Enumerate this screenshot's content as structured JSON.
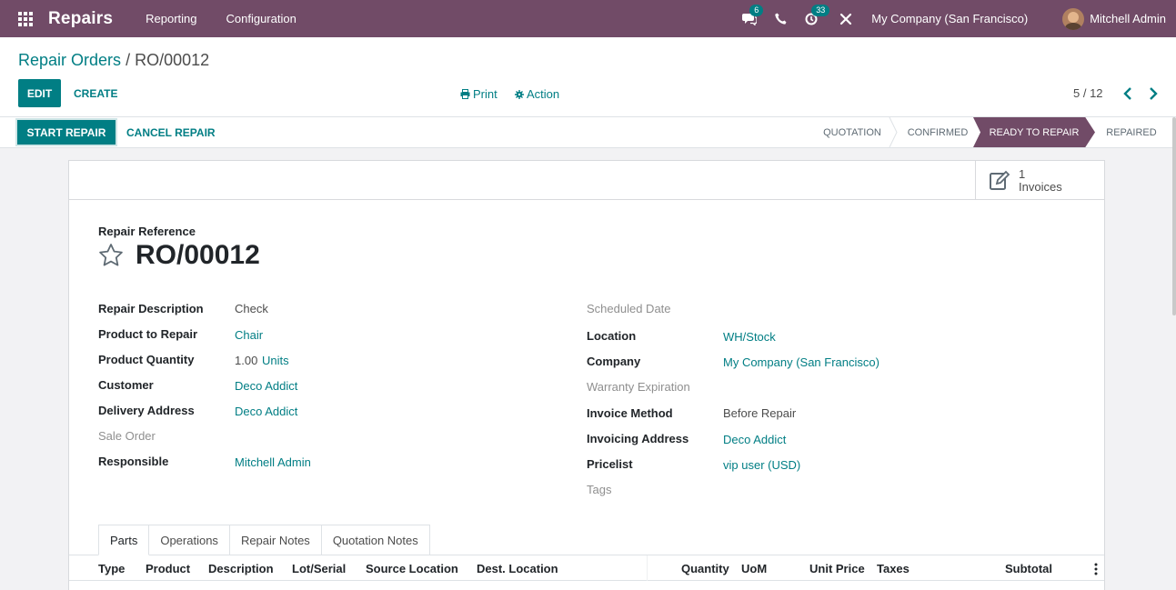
{
  "topbar": {
    "app_name": "Repairs",
    "menu": [
      "Reporting",
      "Configuration"
    ],
    "chat_badge": "6",
    "activity_badge": "33",
    "company": "My Company (San Francisco)",
    "user": "Mitchell Admin"
  },
  "control_panel": {
    "breadcrumb_parent": "Repair Orders",
    "breadcrumb_sep": "/",
    "breadcrumb_current": "RO/00012",
    "edit_label": "EDIT",
    "create_label": "CREATE",
    "print_label": "Print",
    "action_label": "Action",
    "pager": "5 / 12"
  },
  "statusbar": {
    "start_label": "START REPAIR",
    "cancel_label": "CANCEL REPAIR",
    "stages": [
      "QUOTATION",
      "CONFIRMED",
      "READY TO REPAIR",
      "REPAIRED"
    ],
    "active_stage": "READY TO REPAIR"
  },
  "smart_button": {
    "count": "1",
    "label": "Invoices"
  },
  "form": {
    "ref_label": "Repair Reference",
    "ref_value": "RO/00012",
    "left": {
      "repair_description_label": "Repair Description",
      "repair_description": "Check",
      "product_label": "Product to Repair",
      "product": "Chair",
      "quantity_label": "Product Quantity",
      "quantity": "1.00",
      "quantity_uom": "Units",
      "customer_label": "Customer",
      "customer": "Deco Addict",
      "delivery_label": "Delivery Address",
      "delivery": "Deco Addict",
      "sale_order_label": "Sale Order",
      "responsible_label": "Responsible",
      "responsible": "Mitchell Admin"
    },
    "right": {
      "scheduled_label": "Scheduled Date",
      "location_label": "Location",
      "location": "WH/Stock",
      "company_label": "Company",
      "company": "My Company (San Francisco)",
      "warranty_label": "Warranty Expiration",
      "invoice_method_label": "Invoice Method",
      "invoice_method": "Before Repair",
      "invoicing_address_label": "Invoicing Address",
      "invoicing_address": "Deco Addict",
      "pricelist_label": "Pricelist",
      "pricelist": "vip user (USD)",
      "tags_label": "Tags"
    }
  },
  "tabs": [
    "Parts",
    "Operations",
    "Repair Notes",
    "Quotation Notes"
  ],
  "table": {
    "columns": [
      "Type",
      "Product",
      "Description",
      "Lot/Serial",
      "Source Location",
      "Dest. Location",
      "Quantity",
      "UoM",
      "Unit Price",
      "Taxes",
      "Subtotal"
    ]
  },
  "colors": {
    "brand": "#714b67",
    "accent": "#017e84"
  }
}
